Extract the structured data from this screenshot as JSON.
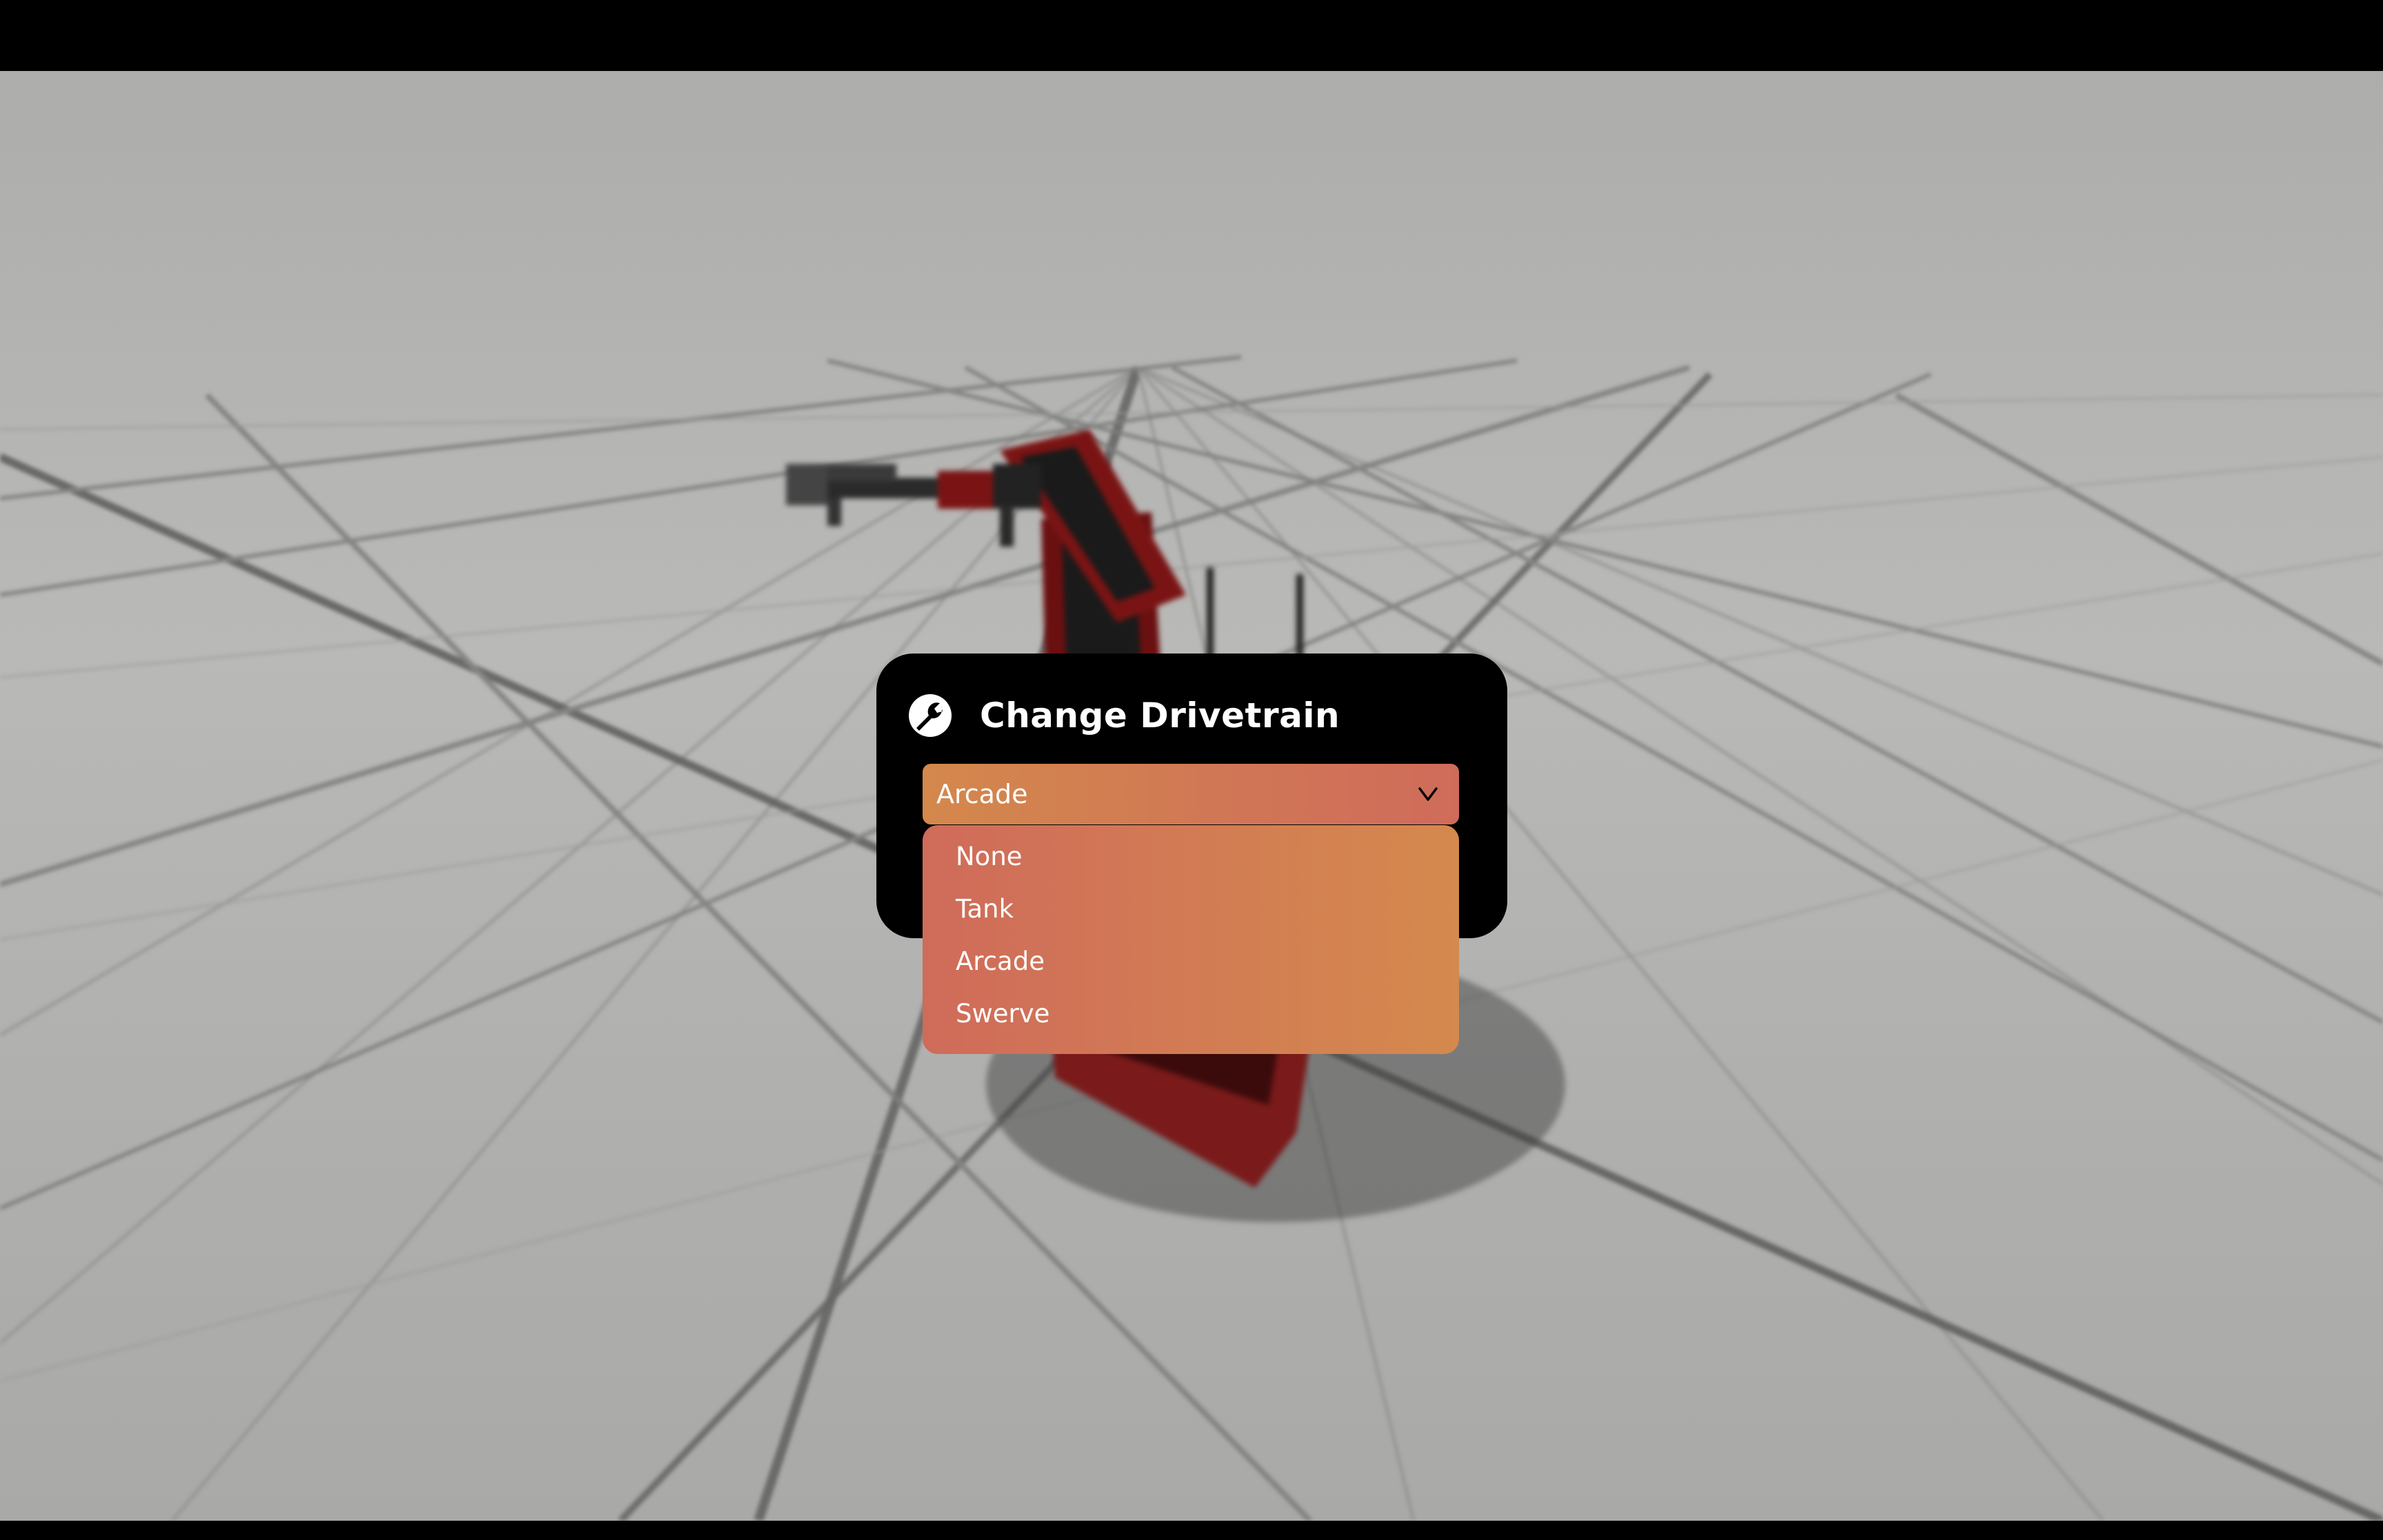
{
  "modal": {
    "title": "Change Drivetrain",
    "icon": "wrench-icon"
  },
  "select": {
    "value": "Arcade",
    "icon": "chevron-down-icon"
  },
  "dropdown": {
    "options": [
      "None",
      "Tank",
      "Arcade",
      "Swerve"
    ]
  },
  "colors": {
    "modal_bg": "#000000",
    "accent_orange": "#d4894d",
    "accent_red": "#cf6b5a",
    "scene_bg": "#b3b3b1",
    "robot_red": "#7a1414"
  }
}
